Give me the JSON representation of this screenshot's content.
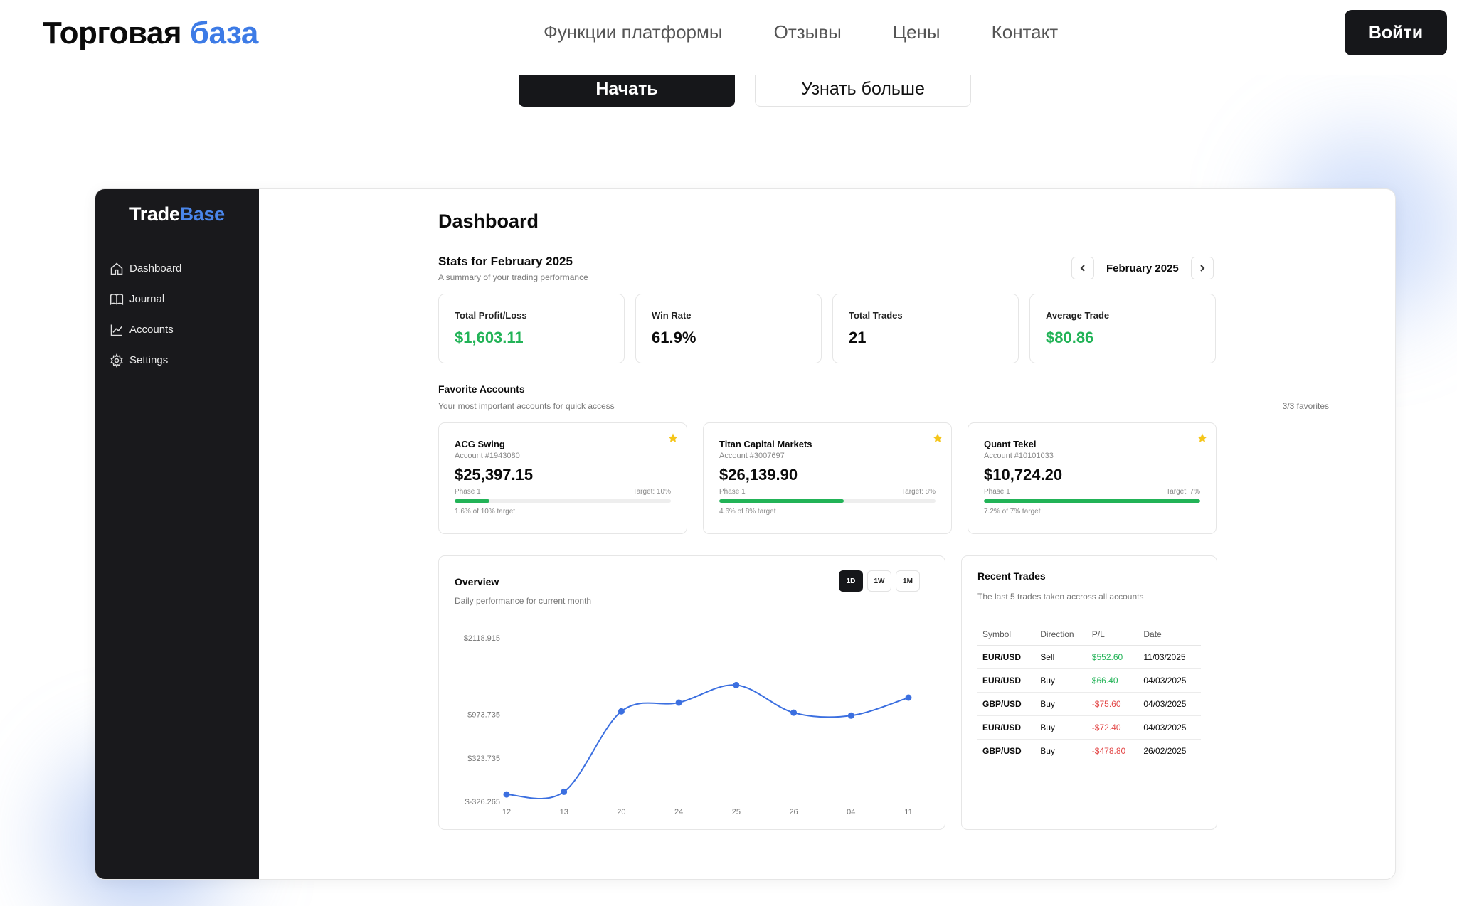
{
  "brand": {
    "name": "Торговая",
    "accent": "база"
  },
  "nav": {
    "links": [
      "Функции платформы",
      "Отзывы",
      "Цены",
      "Контакт"
    ],
    "login": "Войти"
  },
  "hero": {
    "start": "Начать",
    "more": "Узнать больше"
  },
  "app": {
    "brand": {
      "name": "Trade",
      "accent": "Base"
    },
    "sidebar": [
      {
        "label": "Dashboard",
        "icon": "home-icon"
      },
      {
        "label": "Journal",
        "icon": "book-icon"
      },
      {
        "label": "Accounts",
        "icon": "chart-line-icon"
      },
      {
        "label": "Settings",
        "icon": "gear-icon"
      }
    ]
  },
  "dashboard": {
    "title": "Dashboard",
    "stats_title": "Stats for February 2025",
    "stats_subtitle": "A summary of your trading performance",
    "month": "February 2025",
    "stats": [
      {
        "label": "Total Profit/Loss",
        "value": "$1,603.11",
        "tone": "green"
      },
      {
        "label": "Win Rate",
        "value": "61.9%",
        "tone": "dark"
      },
      {
        "label": "Total Trades",
        "value": "21",
        "tone": "dark"
      },
      {
        "label": "Average Trade",
        "value": "$80.86",
        "tone": "green"
      }
    ],
    "favorites": {
      "title": "Favorite Accounts",
      "subtitle": "Your most important accounts for quick access",
      "count": "3/3 favorites",
      "accounts": [
        {
          "name": "ACG Swing",
          "number": "Account #1943080",
          "balance": "$25,397.15",
          "phase": "Phase 1",
          "target": "Target: 10%",
          "progress": 0.16,
          "footer": "1.6% of 10% target"
        },
        {
          "name": "Titan Capital Markets",
          "number": "Account #3007697",
          "balance": "$26,139.90",
          "phase": "Phase 1",
          "target": "Target: 8%",
          "progress": 0.575,
          "footer": "4.6% of 8% target"
        },
        {
          "name": "Quant Tekel",
          "number": "Account #10101033",
          "balance": "$10,724.20",
          "phase": "Phase 1",
          "target": "Target: 7%",
          "progress": 1.0,
          "footer": "7.2% of 7% target"
        }
      ]
    },
    "overview": {
      "title": "Overview",
      "subtitle": "Daily performance for current month",
      "ranges": [
        "1D",
        "1W",
        "1M"
      ],
      "active_range": "1D"
    },
    "recent": {
      "title": "Recent Trades",
      "subtitle": "The last 5 trades taken accross all accounts",
      "columns": [
        "Symbol",
        "Direction",
        "P/L",
        "Date"
      ],
      "rows": [
        {
          "symbol": "EUR/USD",
          "direction": "Sell",
          "pl": "$552.60",
          "date": "11/03/2025",
          "tone": "green"
        },
        {
          "symbol": "EUR/USD",
          "direction": "Buy",
          "pl": "$66.40",
          "date": "04/03/2025",
          "tone": "green"
        },
        {
          "symbol": "GBP/USD",
          "direction": "Buy",
          "pl": "-$75.60",
          "date": "04/03/2025",
          "tone": "red"
        },
        {
          "symbol": "EUR/USD",
          "direction": "Buy",
          "pl": "-$72.40",
          "date": "04/03/2025",
          "tone": "red"
        },
        {
          "symbol": "GBP/USD",
          "direction": "Buy",
          "pl": "-$478.80",
          "date": "26/02/2025",
          "tone": "red"
        }
      ]
    }
  },
  "colors": {
    "accent": "#3d7be6",
    "profit": "#22b357",
    "loss": "#e34848",
    "line": "#3b6fe0",
    "dark": "#16171a"
  },
  "chart_data": {
    "type": "line",
    "categories": [
      "12",
      "13",
      "20",
      "24",
      "25",
      "26",
      "04",
      "11"
    ],
    "values": [
      -221,
      -182,
      1021,
      1151,
      1413,
      1001,
      957,
      1226
    ],
    "y_ticks": [
      "$2118.915",
      "$973.735",
      "$323.735",
      "$-326.265"
    ],
    "y_tick_values": [
      2118.915,
      973.735,
      323.735,
      -326.265
    ],
    "ylim": [
      -326.265,
      2118.915
    ],
    "title": "",
    "xlabel": "",
    "ylabel": "",
    "grid": false
  }
}
